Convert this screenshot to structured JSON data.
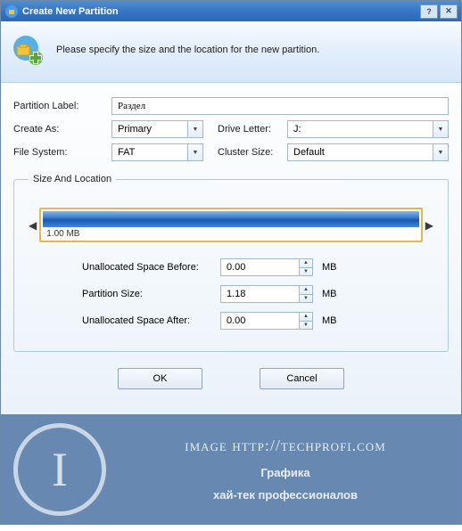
{
  "titlebar": {
    "title": "Create New Partition"
  },
  "header": {
    "instruction": "Please specify the size and the location for the new partition."
  },
  "form": {
    "partition_label_lbl": "Partition Label:",
    "partition_label_val": "Раздел",
    "create_as_lbl": "Create As:",
    "create_as_val": "Primary",
    "drive_letter_lbl": "Drive Letter:",
    "drive_letter_val": "J:",
    "file_system_lbl": "File System:",
    "file_system_val": "FAT",
    "cluster_size_lbl": "Cluster Size:",
    "cluster_size_val": "Default"
  },
  "size_location": {
    "legend": "Size And Location",
    "bar_label": "1.00 MB",
    "rows": {
      "before_lbl": "Unallocated Space Before:",
      "before_val": "0.00",
      "size_lbl": "Partition Size:",
      "size_val": "1.18",
      "after_lbl": "Unallocated Space After:",
      "after_val": "0.00",
      "unit": "MB"
    }
  },
  "buttons": {
    "ok": "OK",
    "cancel": "Cancel"
  },
  "footer": {
    "letter": "I",
    "line1": "image http://techprofi.com",
    "line2": "Графика",
    "line3": "хай-тек профессионалов"
  }
}
